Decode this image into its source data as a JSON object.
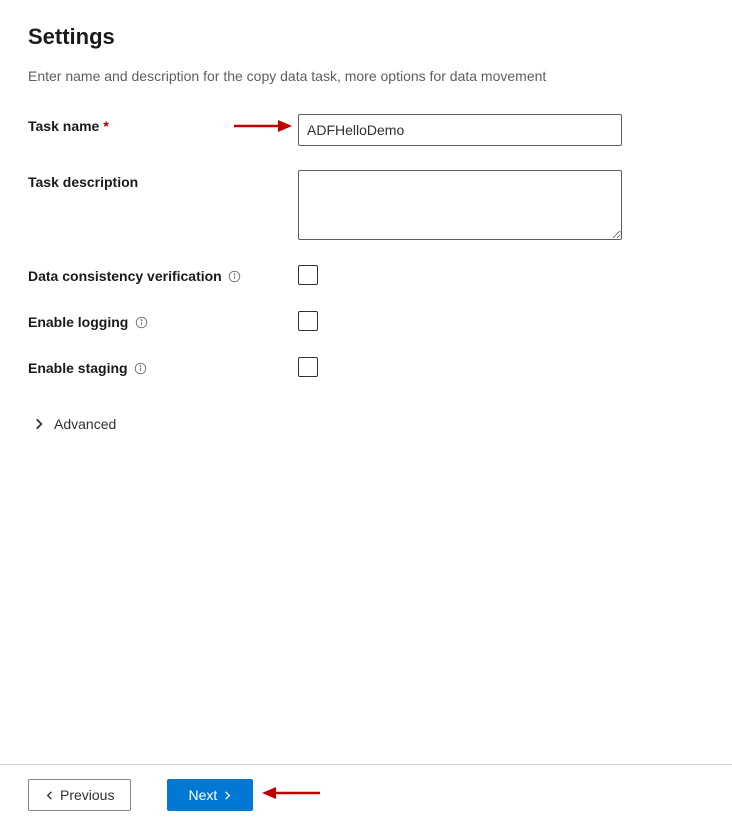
{
  "heading": "Settings",
  "subtitle": "Enter name and description for the copy data task, more options for data movement",
  "labels": {
    "task_name": "Task name",
    "task_description": "Task description",
    "data_consistency": "Data consistency verification",
    "enable_logging": "Enable logging",
    "enable_staging": "Enable staging",
    "advanced": "Advanced"
  },
  "values": {
    "task_name": "ADFHelloDemo",
    "task_description": "",
    "data_consistency_checked": false,
    "enable_logging_checked": false,
    "enable_staging_checked": false
  },
  "buttons": {
    "previous": "Previous",
    "next": "Next"
  },
  "colors": {
    "primary": "#0078d4",
    "annotation": "#c00000"
  }
}
